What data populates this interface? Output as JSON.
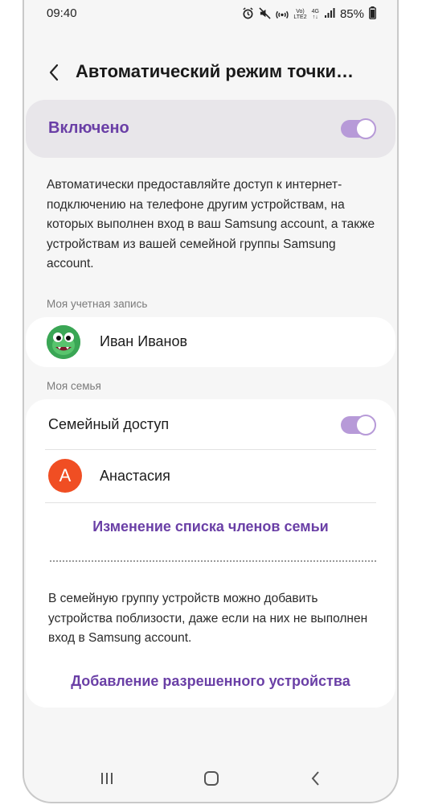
{
  "status_bar": {
    "time": "09:40",
    "volte": "Vo)",
    "lte": "LTE2",
    "net": "4G",
    "battery": "85%"
  },
  "header": {
    "title": "Автоматический режим точки…"
  },
  "toggle": {
    "label": "Включено",
    "state": "on"
  },
  "description": "Автоматически предоставляйте доступ к интернет-подключению на телефоне другим устройствам, на которых выполнен вход в ваш Samsung account, а также устройствам из вашей семейной группы Samsung account.",
  "my_account": {
    "section_label": "Моя учетная запись",
    "name": "Иван Иванов"
  },
  "family": {
    "section_label": "Моя семья",
    "family_access_label": "Семейный доступ",
    "family_access_state": "on",
    "member_initial": "А",
    "member_name": "Анастасия",
    "edit_link": "Изменение списка членов семьи",
    "note": "В семейную группу устройств можно добавить устройства поблизости, даже если на них не выполнен вход в Samsung account.",
    "add_link": "Добавление разрешенного устройства"
  },
  "colors": {
    "accent": "#6a3fa6",
    "switch": "#b79ad8",
    "member_avatar": "#f04e23"
  }
}
